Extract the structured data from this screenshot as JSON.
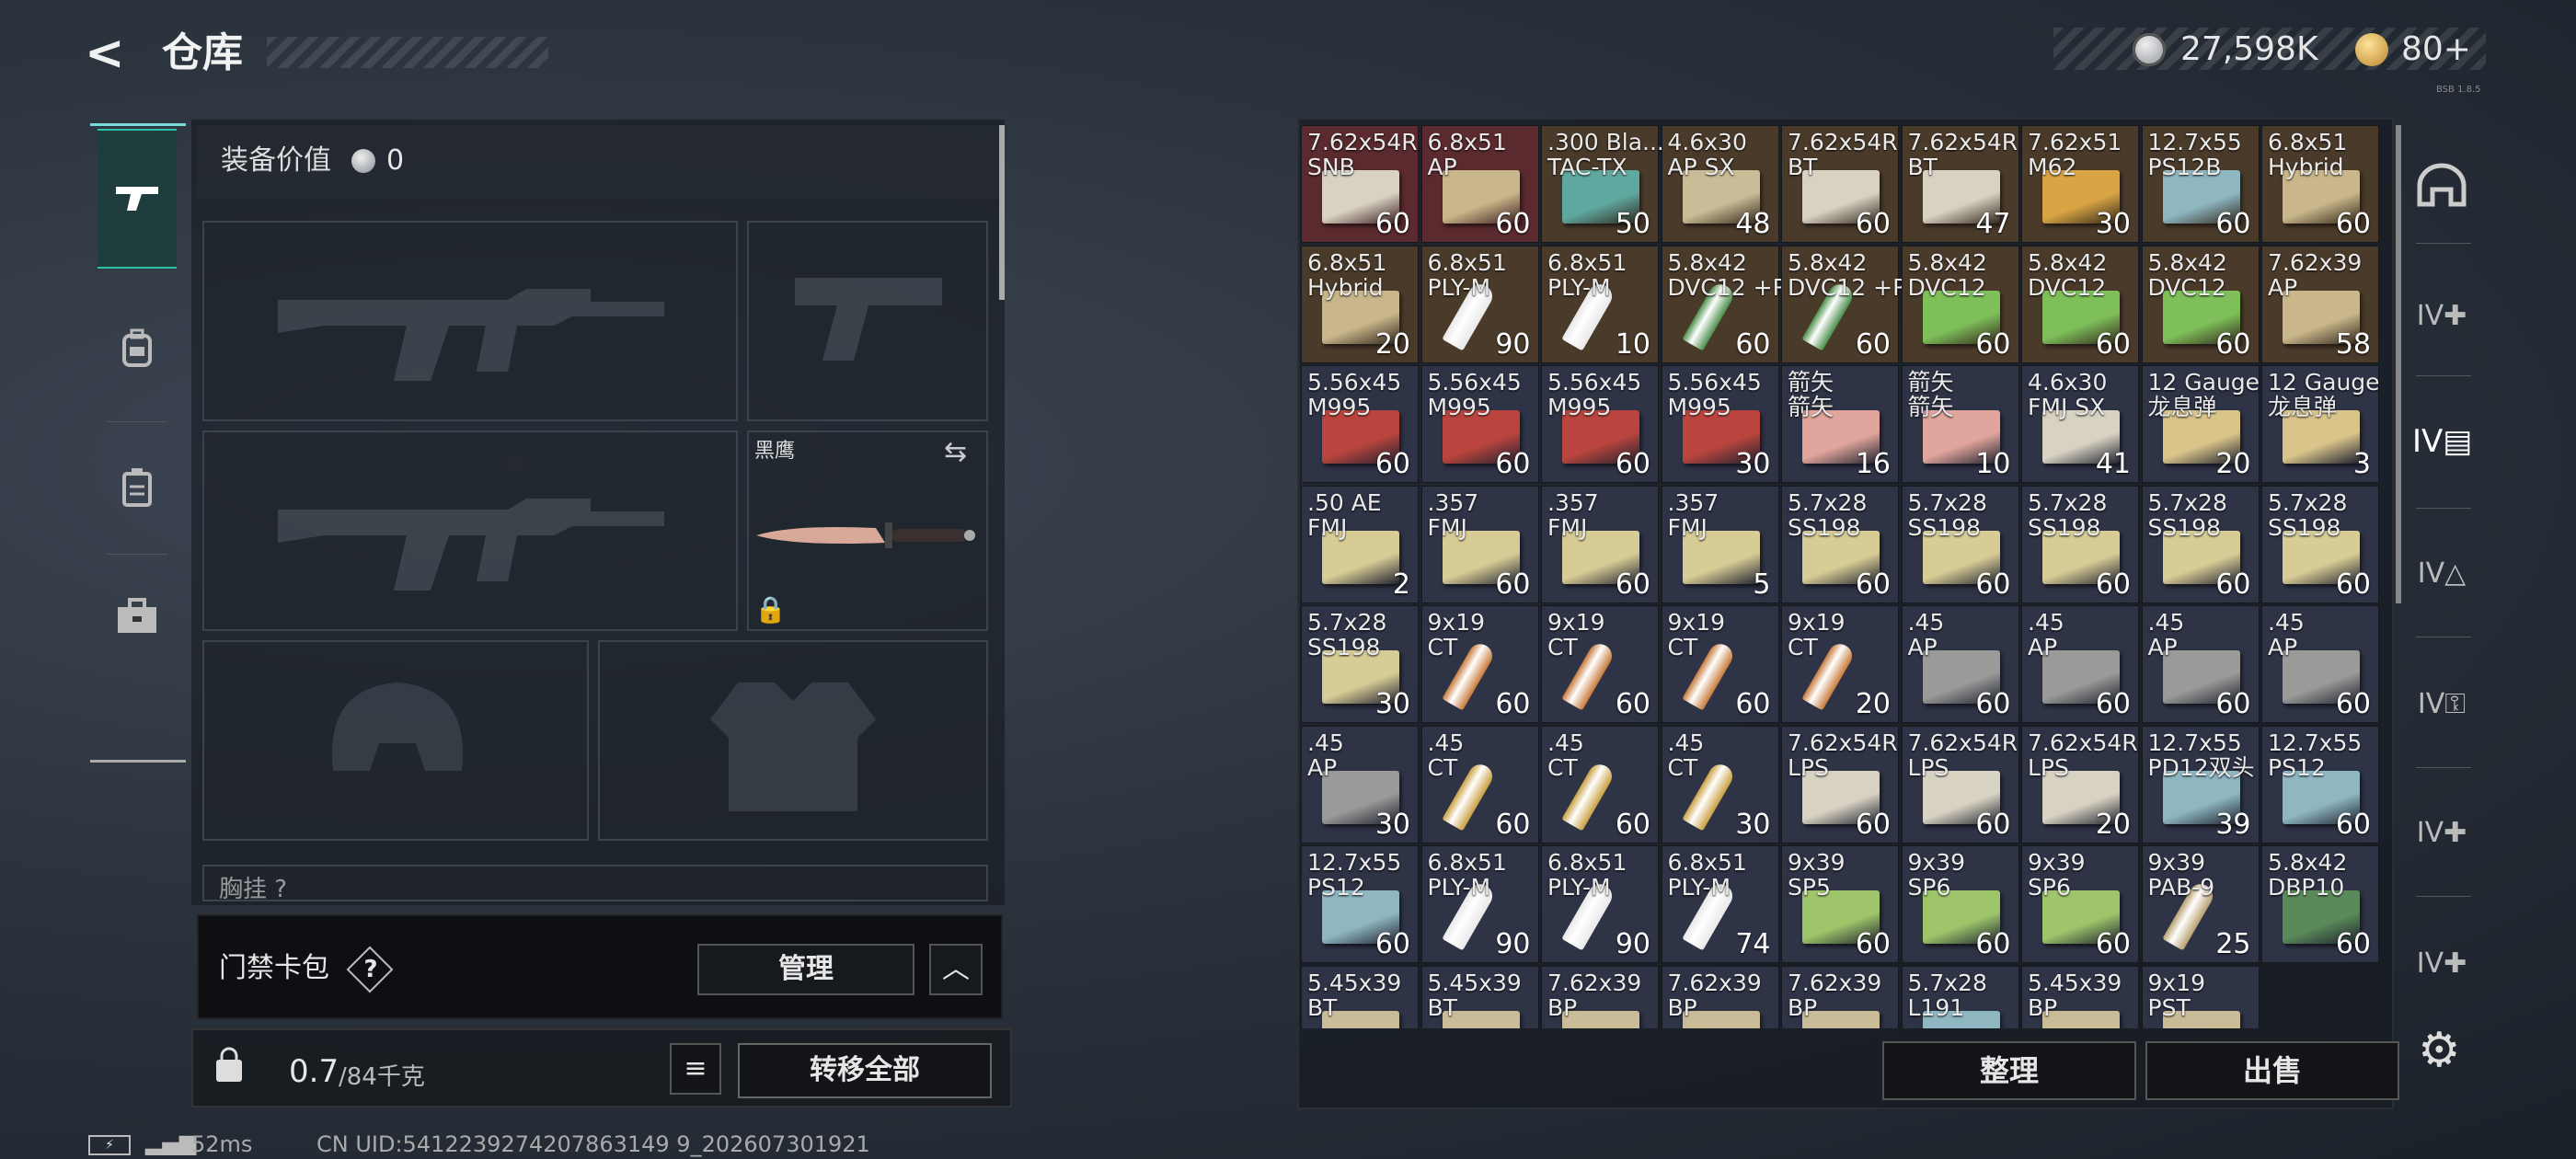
{
  "header": {
    "title": "仓库",
    "back_icon": "back-arrow-icon",
    "silver_amount": "27,598K",
    "gold_amount": "80+",
    "version": "BSB 1.8.5"
  },
  "left_nav": {
    "items": [
      "weapon-icon",
      "backpack-icon",
      "vest-icon",
      "toolbox-icon"
    ]
  },
  "loadout": {
    "equip_value_label": "装备价值",
    "equip_value": "0",
    "melee_name": "黑鹰",
    "chest_label": "胸挂 ?"
  },
  "keycard": {
    "label": "门禁卡包",
    "help": "?",
    "manage_label": "管理",
    "collapse_icon": "chevron-up-icon"
  },
  "weight": {
    "current": "0.7",
    "max": "/84千克",
    "transfer_label": "转移全部"
  },
  "status": {
    "battery": "⚡",
    "ping": "52ms",
    "uid": "CN UID:5412239274207863149 9_202607301921"
  },
  "inventory": {
    "sort_label": "整理",
    "sell_label": "出售",
    "rows": [
      [
        {
          "name": "7.62x54R\nSNB",
          "count": "60",
          "bg": "#5a2a2e",
          "box": "#d8d2c2"
        },
        {
          "name": "6.8x51\nAP",
          "count": "60",
          "bg": "#5a2a2e",
          "box": "#c9b68a"
        },
        {
          "name": ".300 Bla...\nTAC-TX",
          "count": "50",
          "bg": "#4a3a2a",
          "box": "#5fa8a0"
        },
        {
          "name": "4.6x30\nAP SX",
          "count": "48",
          "bg": "#4a3a2a",
          "box": "#c9bc96"
        },
        {
          "name": "7.62x54R\nBT",
          "count": "60",
          "bg": "#4a3a2a",
          "box": "#d8d2c2"
        },
        {
          "name": "7.62x54R\nBT",
          "count": "47",
          "bg": "#4a3a2a",
          "box": "#d8d2c2"
        },
        {
          "name": "7.62x51\nM62",
          "count": "30",
          "bg": "#4a3a2a",
          "box": "#d9a544"
        },
        {
          "name": "12.7x55\nPS12B",
          "count": "60",
          "bg": "#4a3a2a",
          "box": "#8fb7c2"
        },
        {
          "name": "6.8x51\nHybrid",
          "count": "60",
          "bg": "#4a3a2a",
          "box": "#c9b68a"
        }
      ],
      [
        {
          "name": "6.8x51\nHybrid",
          "count": "20",
          "bg": "#4a3a2a",
          "box": "#c9b68a"
        },
        {
          "name": "6.8x51\nPLY-M",
          "count": "90",
          "bg": "#4a3a2a",
          "bullet": "#e8e8e8"
        },
        {
          "name": "6.8x51\nPLY-M",
          "count": "10",
          "bg": "#4a3a2a",
          "bullet": "#e8e8e8"
        },
        {
          "name": "5.8x42\nDVC12 +P",
          "count": "60",
          "bg": "#4a3a2a",
          "bullet": "#4a8f4a"
        },
        {
          "name": "5.8x42\nDVC12 +P",
          "count": "60",
          "bg": "#4a3a2a",
          "bullet": "#4a8f4a"
        },
        {
          "name": "5.8x42\nDVC12",
          "count": "60",
          "bg": "#4a3a2a",
          "box": "#7fbf5a"
        },
        {
          "name": "5.8x42\nDVC12",
          "count": "60",
          "bg": "#4a3a2a",
          "box": "#7fbf5a"
        },
        {
          "name": "5.8x42\nDVC12",
          "count": "60",
          "bg": "#4a3a2a",
          "box": "#7fbf5a"
        },
        {
          "name": "7.62x39\nAP",
          "count": "58",
          "bg": "#4a3a2a",
          "box": "#c9b68a"
        }
      ],
      [
        {
          "name": "5.56x45\nM995",
          "count": "60",
          "bg": "#2e3346",
          "box": "#b9453e"
        },
        {
          "name": "5.56x45\nM995",
          "count": "60",
          "bg": "#2e3346",
          "box": "#b9453e"
        },
        {
          "name": "5.56x45\nM995",
          "count": "60",
          "bg": "#2e3346",
          "box": "#b9453e"
        },
        {
          "name": "5.56x45\nM995",
          "count": "30",
          "bg": "#2e3346",
          "box": "#b9453e"
        },
        {
          "name": "箭矢\n箭矢",
          "count": "16",
          "bg": "#2e3346",
          "box": "#e0a59c"
        },
        {
          "name": "箭矢\n箭矢",
          "count": "10",
          "bg": "#2e3346",
          "box": "#e0a59c"
        },
        {
          "name": "4.6x30\nFMJ SX",
          "count": "41",
          "bg": "#2e3346",
          "box": "#d8d2c2"
        },
        {
          "name": "12 Gauge\n龙息弹",
          "count": "20",
          "bg": "#2e3346",
          "box": "#d9c48a"
        },
        {
          "name": "12 Gauge\n龙息弹",
          "count": "3",
          "bg": "#2e3346",
          "box": "#d9c48a"
        }
      ],
      [
        {
          "name": ".50 AE\nFMJ",
          "count": "2",
          "bg": "#2e3346",
          "box": "#d8cc96"
        },
        {
          "name": ".357\nFMJ",
          "count": "60",
          "bg": "#2e3346",
          "box": "#d8cc96"
        },
        {
          "name": ".357\nFMJ",
          "count": "60",
          "bg": "#2e3346",
          "box": "#d8cc96"
        },
        {
          "name": ".357\nFMJ",
          "count": "5",
          "bg": "#2e3346",
          "box": "#d8cc96"
        },
        {
          "name": "5.7x28\nSS198",
          "count": "60",
          "bg": "#2e3346",
          "box": "#d8cc96"
        },
        {
          "name": "5.7x28\nSS198",
          "count": "60",
          "bg": "#2e3346",
          "box": "#d8cc96"
        },
        {
          "name": "5.7x28\nSS198",
          "count": "60",
          "bg": "#2e3346",
          "box": "#d8cc96"
        },
        {
          "name": "5.7x28\nSS198",
          "count": "60",
          "bg": "#2e3346",
          "box": "#d8cc96"
        },
        {
          "name": "5.7x28\nSS198",
          "count": "60",
          "bg": "#2e3346",
          "box": "#d8cc96"
        }
      ],
      [
        {
          "name": "5.7x28\nSS198",
          "count": "30",
          "bg": "#2e3346",
          "box": "#d8cc96"
        },
        {
          "name": "9x19\nCT",
          "count": "60",
          "bg": "#2e3346",
          "bullet": "#c87a3a"
        },
        {
          "name": "9x19\nCT",
          "count": "60",
          "bg": "#2e3346",
          "bullet": "#c87a3a"
        },
        {
          "name": "9x19\nCT",
          "count": "60",
          "bg": "#2e3346",
          "bullet": "#c87a3a"
        },
        {
          "name": "9x19\nCT",
          "count": "20",
          "bg": "#2e3346",
          "bullet": "#c87a3a"
        },
        {
          "name": ".45\nAP",
          "count": "60",
          "bg": "#2e3346",
          "box": "#9a9a98"
        },
        {
          "name": ".45\nAP",
          "count": "60",
          "bg": "#2e3346",
          "box": "#9a9a98"
        },
        {
          "name": ".45\nAP",
          "count": "60",
          "bg": "#2e3346",
          "box": "#9a9a98"
        },
        {
          "name": ".45\nAP",
          "count": "60",
          "bg": "#2e3346",
          "box": "#9a9a98"
        }
      ],
      [
        {
          "name": ".45\nAP",
          "count": "30",
          "bg": "#2e3346",
          "box": "#9a9a98"
        },
        {
          "name": ".45\nCT",
          "count": "60",
          "bg": "#2e3346",
          "bullet": "#c9a040"
        },
        {
          "name": ".45\nCT",
          "count": "60",
          "bg": "#2e3346",
          "bullet": "#c9a040"
        },
        {
          "name": ".45\nCT",
          "count": "30",
          "bg": "#2e3346",
          "bullet": "#c9a040"
        },
        {
          "name": "7.62x54R\nLPS",
          "count": "60",
          "bg": "#2e3346",
          "box": "#d8d2c2"
        },
        {
          "name": "7.62x54R\nLPS",
          "count": "60",
          "bg": "#2e3346",
          "box": "#d8d2c2"
        },
        {
          "name": "7.62x54R\nLPS",
          "count": "20",
          "bg": "#2e3346",
          "box": "#d8d2c2"
        },
        {
          "name": "12.7x55\nPD12双头",
          "count": "39",
          "bg": "#2e3346",
          "box": "#8fb7c2"
        },
        {
          "name": "12.7x55\nPS12",
          "count": "60",
          "bg": "#2e3346",
          "box": "#8fb7c2"
        }
      ],
      [
        {
          "name": "12.7x55\nPS12",
          "count": "60",
          "bg": "#2e3346",
          "box": "#8fb7c2"
        },
        {
          "name": "6.8x51\nPLY-M",
          "count": "90",
          "bg": "#2e3346",
          "bullet": "#e8e8e8"
        },
        {
          "name": "6.8x51\nPLY-M",
          "count": "90",
          "bg": "#2e3346",
          "bullet": "#e8e8e8"
        },
        {
          "name": "6.8x51\nPLY-M",
          "count": "74",
          "bg": "#2e3346",
          "bullet": "#e8e8e8"
        },
        {
          "name": "9x39\nSP5",
          "count": "60",
          "bg": "#2e3346",
          "box": "#9ec56a"
        },
        {
          "name": "9x39\nSP6",
          "count": "60",
          "bg": "#2e3346",
          "box": "#9ec56a"
        },
        {
          "name": "9x39\nSP6",
          "count": "60",
          "bg": "#2e3346",
          "box": "#9ec56a"
        },
        {
          "name": "9x39\nPAB-9",
          "count": "25",
          "bg": "#2e3346",
          "bullet": "#b8a070"
        },
        {
          "name": "5.8x42\nDBP10",
          "count": "60",
          "bg": "#2e3346",
          "box": "#5a8a5a"
        }
      ],
      [
        {
          "name": "5.45x39\nBT",
          "count": "",
          "bg": "#2e3346",
          "box": "#c9bc96"
        },
        {
          "name": "5.45x39\nBT",
          "count": "",
          "bg": "#2e3346",
          "box": "#c9bc96"
        },
        {
          "name": "7.62x39\nBP",
          "count": "",
          "bg": "#2e3346",
          "box": "#c9bc96"
        },
        {
          "name": "7.62x39\nBP",
          "count": "",
          "bg": "#2e3346",
          "box": "#c9bc96"
        },
        {
          "name": "7.62x39\nBP",
          "count": "",
          "bg": "#2e3346",
          "box": "#c9bc96"
        },
        {
          "name": "5.7x28\nL191",
          "count": "",
          "bg": "#2e3346",
          "box": "#8fb7c2"
        },
        {
          "name": "5.45x39\nBP",
          "count": "",
          "bg": "#2e3346",
          "box": "#c9bc96"
        },
        {
          "name": "9x19\nPST",
          "count": "",
          "bg": "#2e3346",
          "box": "#c9bc96"
        }
      ]
    ]
  },
  "right_sidebar": {
    "items": [
      "helmet-slot-icon",
      "iv-medkit-icon",
      "iv-folder-icon",
      "iv-triangle-icon",
      "iv-key-icon",
      "iv-medkit-2-icon",
      "iv-medkit-3-icon"
    ],
    "gear_icon": "gear-icon"
  }
}
